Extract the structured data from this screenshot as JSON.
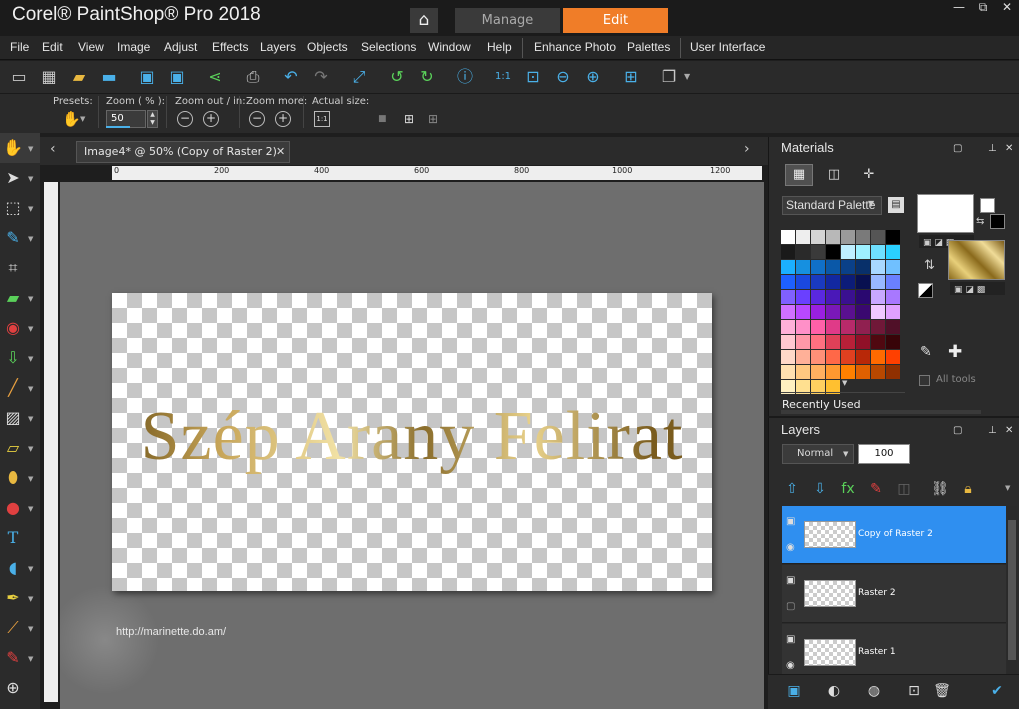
{
  "app": {
    "title": "Corel® PaintShop® Pro 2018"
  },
  "workspace_tabs": {
    "manage": "Manage",
    "edit": "Edit"
  },
  "window_controls": {
    "min": "—",
    "restore": "⧉",
    "close": "✕"
  },
  "menu": [
    "File",
    "Edit",
    "View",
    "Image",
    "Adjust",
    "Effects",
    "Layers",
    "Objects",
    "Selections",
    "Window",
    "Help",
    "Enhance Photo",
    "Palettes",
    "User Interface"
  ],
  "toolbar": [
    "new-icon",
    "grid-icon",
    "open-icon",
    "scan-icon",
    "save-icon",
    "save-as-icon",
    "share-icon",
    "print-icon",
    "undo-icon",
    "redo-icon",
    "resize-icon",
    "rotate-left-icon",
    "rotate-right-icon",
    "info-icon",
    "actual-size-icon",
    "fit-window-icon",
    "zoom-out-icon",
    "zoom-in-icon",
    "zoom-fit-icon",
    "paste-icon"
  ],
  "options": {
    "presets_label": "Presets:",
    "zoom_label": "Zoom ( % ):",
    "zoom_value": "50",
    "zoomout_label": "Zoom out / in:",
    "zoommore_label": "Zoom more:",
    "actual_label": "Actual size:",
    "actual_icon": "1:1"
  },
  "document": {
    "tab": "Image4* @  50% (Copy of Raster 2)",
    "text": "Szép Arany Felirat",
    "watermark": "http://marinette.do.am/"
  },
  "ruler_ticks": [
    "0",
    "200",
    "400",
    "600",
    "800",
    "1000",
    "1200"
  ],
  "materials": {
    "title": "Materials",
    "palette": "Standard Palette",
    "recently_used": "Recently Used",
    "all_tools": "All tools",
    "swatches": [
      "#ffffff",
      "#eeeeee",
      "#d4d4d4",
      "#b8b8b8",
      "#9a9a9a",
      "#7a7a7a",
      "#555555",
      "#000000",
      "#1a1a1a",
      "#2a2a2a",
      "#3a3a3a",
      "#000000",
      "#bfefff",
      "#9ef0ff",
      "#6fe0ff",
      "#2ad0ff",
      "#1bb0ff",
      "#1690e0",
      "#1070c8",
      "#0a58a8",
      "#0a4088",
      "#08306a",
      "#a8d8ff",
      "#70c0ff",
      "#1e60ff",
      "#1a48e0",
      "#1a3ac0",
      "#1228a0",
      "#0c1c78",
      "#081050",
      "#98b8ff",
      "#6a80ff",
      "#8060ff",
      "#6a40ff",
      "#5a28e0",
      "#4a18b8",
      "#3a1090",
      "#2a0870",
      "#c8a8ff",
      "#a878ff",
      "#d070ff",
      "#b848ff",
      "#9a20e0",
      "#7a18b8",
      "#5a1090",
      "#3a0870",
      "#f0c8ff",
      "#e0a0ff",
      "#ffb0d8",
      "#ff90c8",
      "#ff60a8",
      "#e03a88",
      "#b82a6a",
      "#902050",
      "#701838",
      "#501028",
      "#ffc8d0",
      "#ff98a8",
      "#ff7080",
      "#e04058",
      "#b82038",
      "#901028",
      "#500810",
      "#380408",
      "#ffd8c8",
      "#ffb098",
      "#ff9078",
      "#ff6848",
      "#e04020",
      "#b82808",
      "#ff6a00",
      "#ff4000",
      "#ffe0b0",
      "#ffc880",
      "#ffb060",
      "#ff9830",
      "#ff8000",
      "#e06000",
      "#b84800",
      "#903000",
      "#fff0c0",
      "#ffe090",
      "#ffd060",
      "#ffc030"
    ]
  },
  "layers": {
    "title": "Layers",
    "blend": "Normal",
    "opacity": "100",
    "items": [
      {
        "name": "Copy of Raster 2",
        "selected": true
      },
      {
        "name": "Raster 2",
        "selected": false
      },
      {
        "name": "Raster 1",
        "selected": false
      }
    ]
  }
}
